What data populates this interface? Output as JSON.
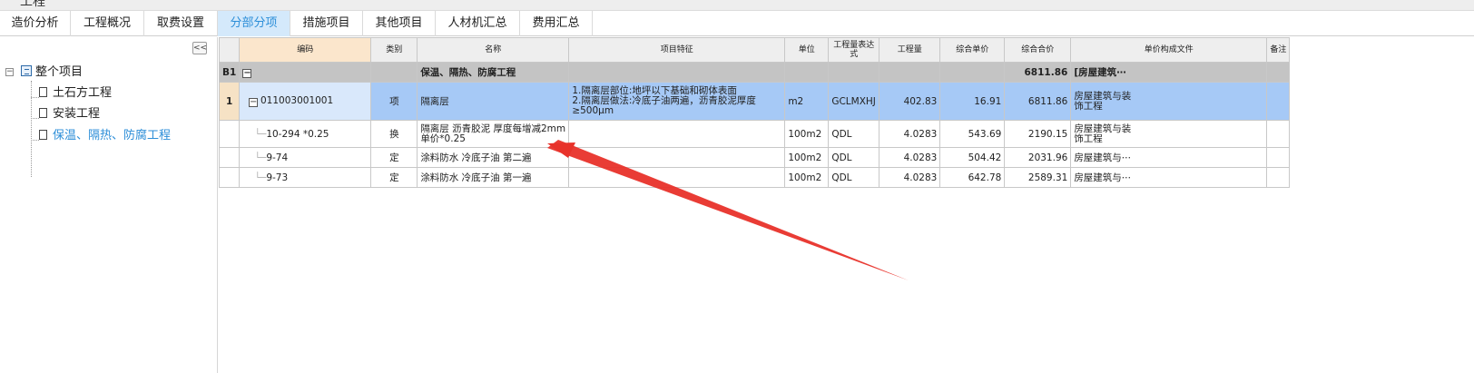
{
  "window": {
    "title": "工程"
  },
  "tabs": [
    {
      "label": "造价分析",
      "active": false
    },
    {
      "label": "工程概况",
      "active": false
    },
    {
      "label": "取费设置",
      "active": false
    },
    {
      "label": "分部分项",
      "active": true
    },
    {
      "label": "措施项目",
      "active": false
    },
    {
      "label": "其他项目",
      "active": false
    },
    {
      "label": "人材机汇总",
      "active": false
    },
    {
      "label": "费用汇总",
      "active": false
    }
  ],
  "sidebar": {
    "collapse_label": "<<",
    "root": {
      "label": "整个项目",
      "toggle": "−"
    },
    "items": [
      {
        "label": "土石方工程",
        "active": false
      },
      {
        "label": "安装工程",
        "active": false
      },
      {
        "label": "保温、隔热、防腐工程",
        "active": true
      }
    ]
  },
  "grid": {
    "headers": {
      "code": "编码",
      "type": "类别",
      "name": "名称",
      "feature": "项目特征",
      "unit": "单位",
      "expr": "工程量表达式",
      "qty": "工程量",
      "unit_price": "综合单价",
      "total": "综合合价",
      "fee_file": "单价构成文件",
      "note": "备注"
    },
    "section_row": {
      "row_num": "B1",
      "toggle": "−",
      "name": "保温、隔热、防腐工程",
      "total": "6811.86",
      "fee_file": "[房屋建筑⋯"
    },
    "item_row": {
      "row_num": "1",
      "toggle": "−",
      "code": "011003001001",
      "type": "项",
      "name": "隔离层",
      "feature_line1": "1.隔离层部位:地坪以下基础和砌体表面",
      "feature_line2": "2.隔离层做法:冷底子油两遍，沥青胶泥厚度",
      "feature_line3": "≥500μm",
      "unit": "m2",
      "expr": "GCLMXHJ",
      "qty": "402.83",
      "unit_price": "16.91",
      "total": "6811.86",
      "fee_file_line1": "房屋建筑与装",
      "fee_file_line2": "饰工程"
    },
    "quota_rows": [
      {
        "code": "10-294 *0.25",
        "type": "换",
        "name_line1": "隔离层 沥青胶泥 厚度每增减2mm",
        "name_line2": "单价*0.25",
        "unit": "100m2",
        "expr": "QDL",
        "qty": "4.0283",
        "unit_price": "543.69",
        "total": "2190.15",
        "fee_file_line1": "房屋建筑与装",
        "fee_file_line2": "饰工程"
      },
      {
        "code": "9-74",
        "type": "定",
        "name_line1": "涂料防水 冷底子油 第二遍",
        "unit": "100m2",
        "expr": "QDL",
        "qty": "4.0283",
        "unit_price": "504.42",
        "total": "2031.96",
        "fee_file_line1": "房屋建筑与⋯"
      },
      {
        "code": "9-73",
        "type": "定",
        "name_line1": "涂料防水 冷底子油 第一遍",
        "unit": "100m2",
        "expr": "QDL",
        "qty": "4.0283",
        "unit_price": "642.78",
        "total": "2589.31",
        "fee_file_line1": "房屋建筑与⋯"
      }
    ]
  },
  "annotation": {
    "arrow_color": "#e8322a"
  }
}
